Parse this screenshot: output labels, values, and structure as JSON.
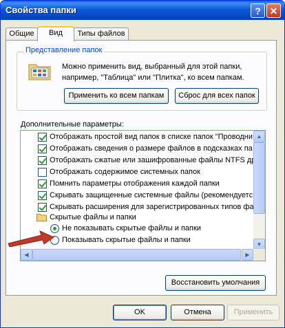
{
  "window": {
    "title": "Свойства папки"
  },
  "tabs": [
    {
      "label": "Общие"
    },
    {
      "label": "Вид"
    },
    {
      "label": "Типы файлов"
    }
  ],
  "folder_view": {
    "group_label": "Представление папок",
    "description": "Можно применить вид, выбранный для этой папки, например, \"Таблица\" или \"Плитка\", ко всем папкам.",
    "apply_all_label": "Применить ко всем папкам",
    "reset_all_label": "Сброс для всех папок"
  },
  "advanced": {
    "label": "Дополнительные параметры:",
    "items": [
      {
        "text": "Отображать простой вид папок в списке папок \"Проводни",
        "checked": true
      },
      {
        "text": "Отображать сведения о размере файлов в подсказках па",
        "checked": true
      },
      {
        "text": "Отображать сжатые или зашифрованные файлы NTFS др",
        "checked": true
      },
      {
        "text": "Отображать содержимое системных папок",
        "checked": false
      },
      {
        "text": "Помнить параметры отображения каждой папки",
        "checked": true
      },
      {
        "text": "Скрывать защищенные системные файлы (рекомендуетс",
        "checked": true
      },
      {
        "text": "Скрывать расширения для зарегистрированных типов фа",
        "checked": true
      }
    ],
    "hidden_group_label": "Скрытые файлы и папки",
    "radio_options": [
      {
        "text": "Не показывать скрытые файлы и папки",
        "selected": true
      },
      {
        "text": "Показывать скрытые файлы и папки",
        "selected": false
      }
    ],
    "restore_label": "Восстановить умолчания"
  },
  "footer": {
    "ok_label": "OK",
    "cancel_label": "Отмена",
    "apply_label": "Применить"
  },
  "colors": {
    "accent": "#0046d5",
    "check": "#21a121",
    "arrow": "#c0392b",
    "titlebar": "#0b5ad8"
  }
}
